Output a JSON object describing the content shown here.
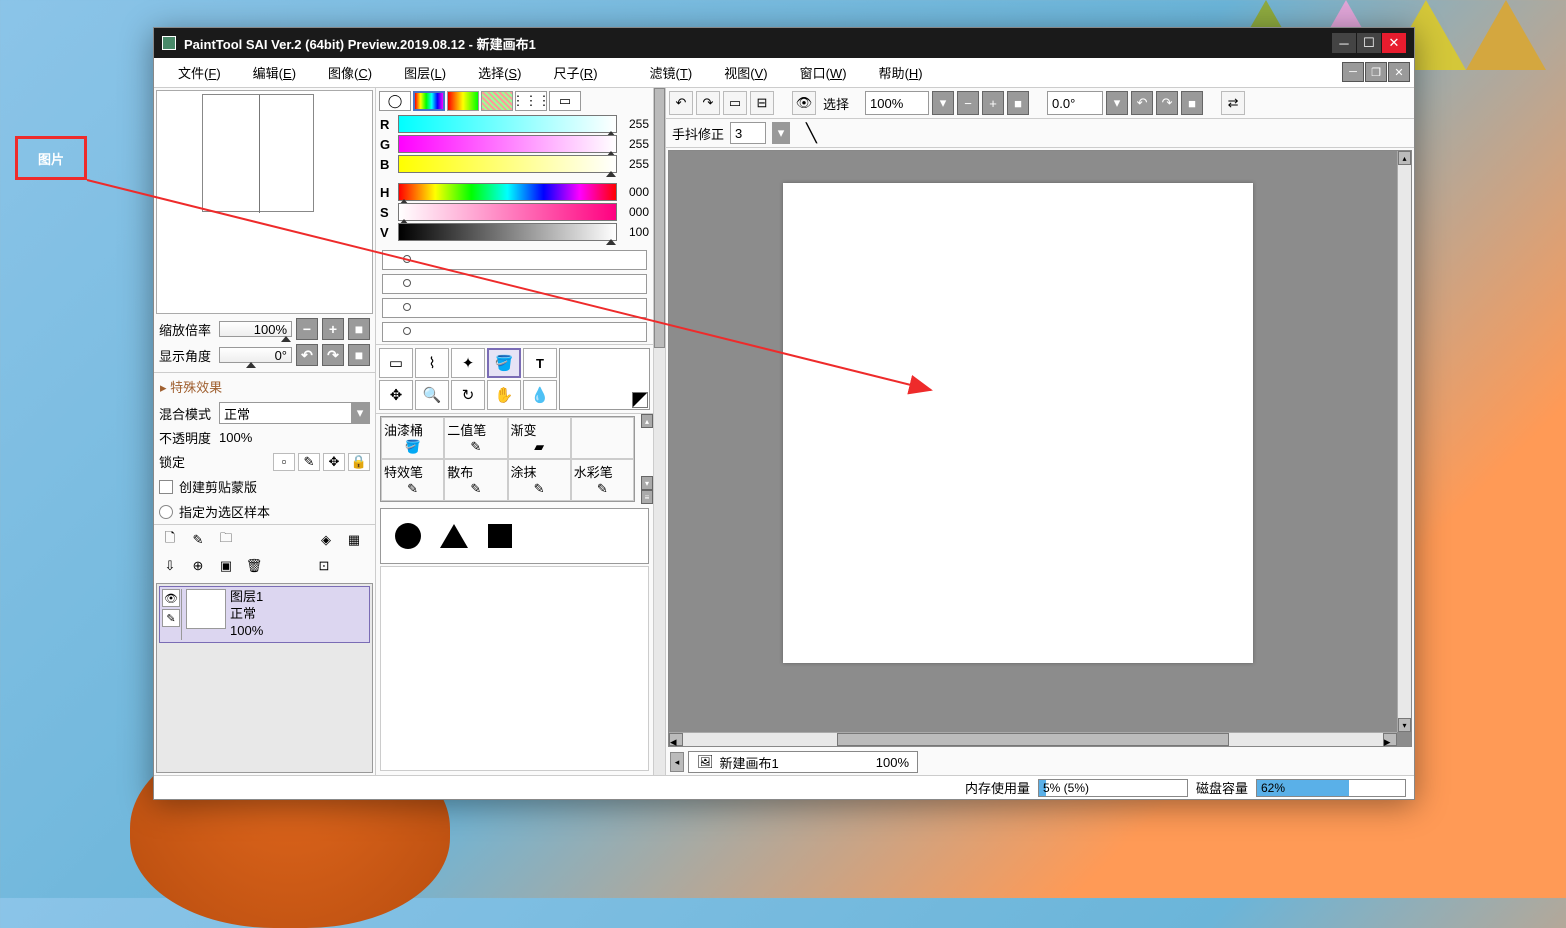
{
  "annotation": {
    "label": "图片"
  },
  "titlebar": {
    "text": "PaintTool SAI Ver.2 (64bit) Preview.2019.08.12 - 新建画布1"
  },
  "menu": {
    "file": "文件",
    "file_k": "F",
    "edit": "编辑",
    "edit_k": "E",
    "image": "图像",
    "image_k": "C",
    "layer": "图层",
    "layer_k": "L",
    "select": "选择",
    "select_k": "S",
    "ruler": "尺子",
    "ruler_k": "R",
    "filter": "滤镜",
    "filter_k": "T",
    "view": "视图",
    "view_k": "V",
    "window": "窗口",
    "window_k": "W",
    "help": "帮助",
    "help_k": "H"
  },
  "nav": {
    "zoom_label": "缩放倍率",
    "zoom_value": "100%",
    "angle_label": "显示角度",
    "angle_value": "0°"
  },
  "effects": {
    "header": "特殊效果"
  },
  "blend": {
    "label": "混合模式",
    "value": "正常"
  },
  "opacity": {
    "label": "不透明度",
    "value": "100%"
  },
  "lock": {
    "label": "锁定"
  },
  "clip": {
    "label": "创建剪贴蒙版"
  },
  "sample": {
    "label": "指定为选区样本"
  },
  "layer": {
    "name": "图层1",
    "mode": "正常",
    "opacity": "100%"
  },
  "rgb": {
    "r_l": "R",
    "r_v": "255",
    "g_l": "G",
    "g_v": "255",
    "b_l": "B",
    "b_v": "255",
    "h_l": "H",
    "h_v": "000",
    "s_l": "S",
    "s_v": "000",
    "v_l": "V",
    "v_v": "100"
  },
  "brushes": {
    "a1": "油漆桶",
    "a2": "二值笔",
    "a3": "渐变",
    "a4": "",
    "b1": "特效笔",
    "b2": "散布",
    "b3": "涂抹",
    "b4": "水彩笔"
  },
  "toolbar": {
    "select_label": "选择",
    "zoom": "100%",
    "angle": "0.0°"
  },
  "stabilizer": {
    "label": "手抖修正",
    "value": "3"
  },
  "doctab": {
    "name": "新建画布1",
    "zoom": "100%"
  },
  "status": {
    "mem_label": "内存使用量",
    "mem_value": "5% (5%)",
    "disk_label": "磁盘容量",
    "disk_value": "62%"
  }
}
